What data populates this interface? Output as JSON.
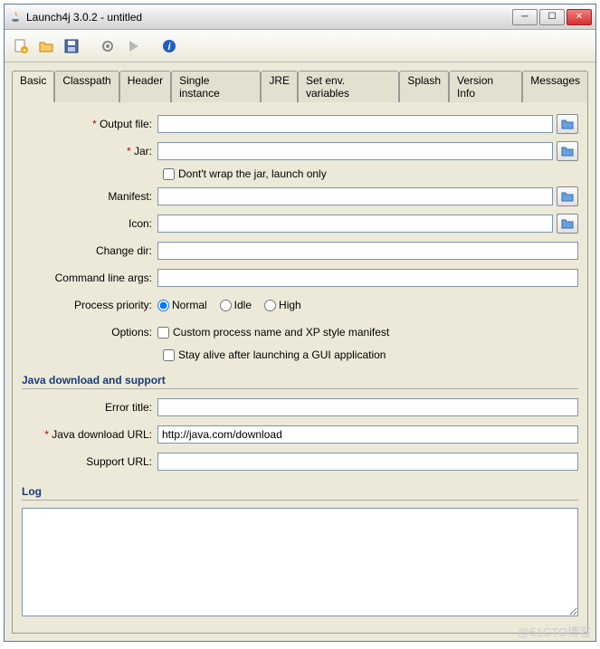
{
  "window": {
    "title": "Launch4j 3.0.2 - untitled"
  },
  "toolbar": {
    "new": "new-file",
    "open": "open-folder",
    "save": "save",
    "settings": "gear",
    "run": "play",
    "info": "info"
  },
  "tabs": [
    "Basic",
    "Classpath",
    "Header",
    "Single instance",
    "JRE",
    "Set env. variables",
    "Splash",
    "Version Info",
    "Messages"
  ],
  "form": {
    "output_file": {
      "label": "Output file:",
      "value": "",
      "required": true
    },
    "jar": {
      "label": "Jar:",
      "value": "",
      "required": true
    },
    "dont_wrap": "Dont't wrap the jar, launch only",
    "manifest": {
      "label": "Manifest:",
      "value": ""
    },
    "icon": {
      "label": "Icon:",
      "value": ""
    },
    "change_dir": {
      "label": "Change dir:",
      "value": ""
    },
    "cmd_args": {
      "label": "Command line args:",
      "value": ""
    },
    "priority": {
      "label": "Process priority:",
      "normal": "Normal",
      "idle": "Idle",
      "high": "High"
    },
    "options": {
      "label": "Options:",
      "custom": "Custom process name and XP style manifest",
      "stay_alive": "Stay alive after launching a GUI application"
    }
  },
  "java_section": {
    "title": "Java download and support",
    "error_title": {
      "label": "Error title:",
      "value": ""
    },
    "download_url": {
      "label": "Java download URL:",
      "value": "http://java.com/download",
      "required": true
    },
    "support_url": {
      "label": "Support URL:",
      "value": ""
    }
  },
  "log_section": {
    "title": "Log"
  },
  "watermark": "@51CTO博客"
}
